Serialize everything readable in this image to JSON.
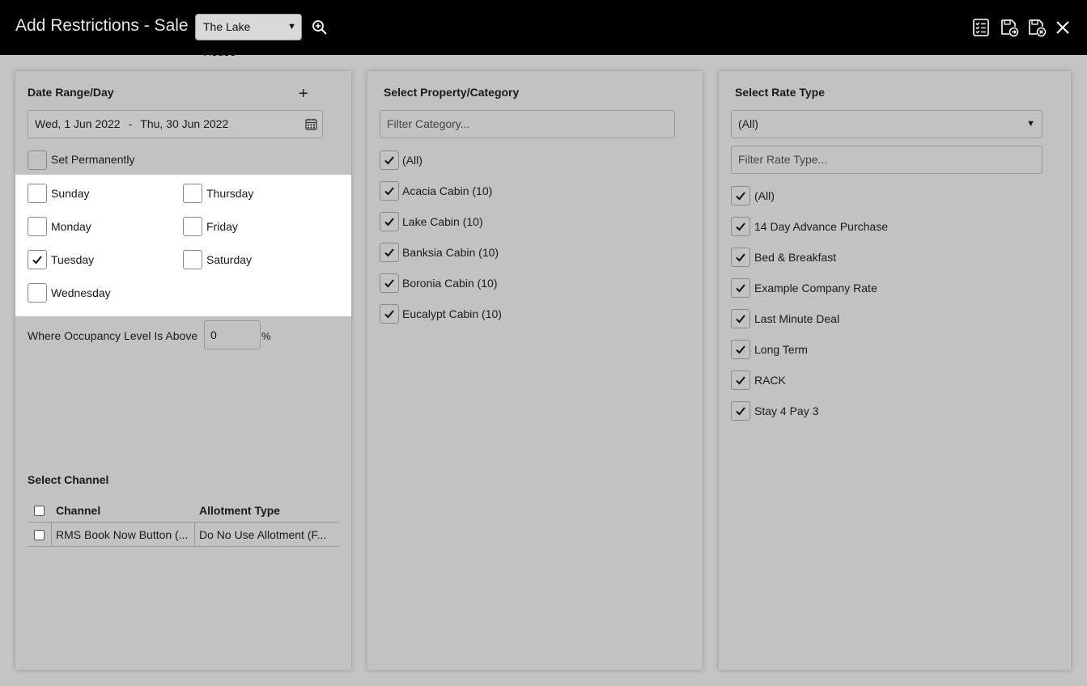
{
  "header": {
    "title": "Add Restrictions - Sale",
    "property_select": "The Lake House"
  },
  "date_panel": {
    "title": "Date Range/Day",
    "add": "+",
    "date_from": "Wed, 1 Jun 2022",
    "date_sep": "-",
    "date_to": "Thu, 30 Jun 2022",
    "set_permanently": "Set Permanently",
    "days": {
      "sunday": "Sunday",
      "monday": "Monday",
      "tuesday": "Tuesday",
      "wednesday": "Wednesday",
      "thursday": "Thursday",
      "friday": "Friday",
      "saturday": "Saturday"
    },
    "occupancy_label": "Where Occupancy Level Is Above",
    "occupancy_value": "0",
    "occupancy_unit": "%"
  },
  "channel": {
    "title": "Select Channel",
    "headers": [
      "Channel",
      "Allotment Type"
    ],
    "rows": [
      {
        "channel": "RMS Book Now Button (...",
        "allotment": "Do No Use Allotment (F..."
      }
    ]
  },
  "category_panel": {
    "title": "Select Property/Category",
    "filter_placeholder": "Filter Category...",
    "items": [
      "(All)",
      "Acacia Cabin (10)",
      "Lake Cabin (10)",
      "Banksia Cabin (10)",
      "Boronia Cabin (10)",
      "Eucalypt Cabin (10)"
    ]
  },
  "rate_panel": {
    "title": "Select Rate Type",
    "select_value": "(All)",
    "filter_placeholder": "Filter Rate Type...",
    "items": [
      "(All)",
      "14 Day Advance Purchase",
      "Bed & Breakfast",
      "Example Company Rate",
      "Last Minute Deal",
      "Long Term",
      "RACK",
      "Stay 4 Pay 3"
    ]
  },
  "icons": {
    "zoom": "zoom-in-icon",
    "checklist": "checklist-icon",
    "save_next": "save-arrow-icon",
    "save_close": "save-close-icon",
    "close": "close-icon",
    "calendar": "calendar-icon",
    "check": "checkmark-icon"
  }
}
